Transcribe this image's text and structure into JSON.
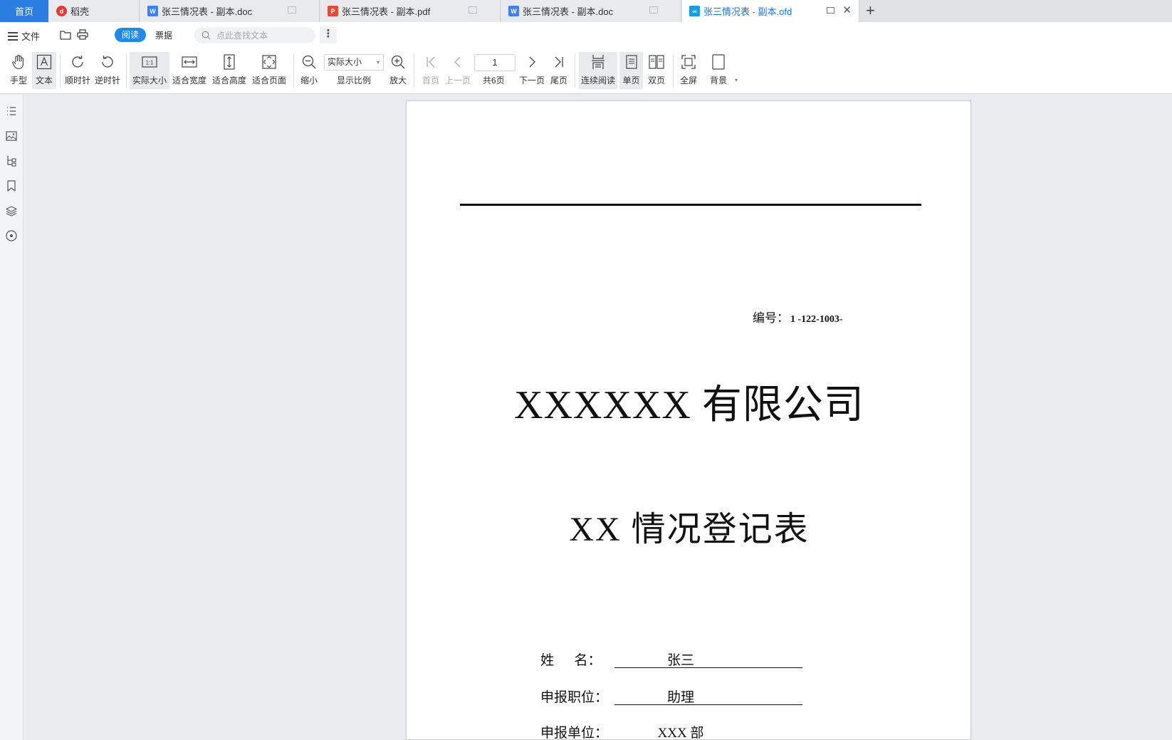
{
  "tabs": [
    {
      "label": "首页",
      "active": false
    },
    {
      "label": "稻壳",
      "active": false,
      "icon": "daoke-icon"
    },
    {
      "label": "张三情况表 - 副本.doc",
      "active": false,
      "icon": "word-doc-icon"
    },
    {
      "label": "张三情况表 - 副本.pdf",
      "active": false,
      "icon": "pdf-icon"
    },
    {
      "label": "张三情况表 - 副本.doc",
      "active": false,
      "icon": "word-doc-icon"
    },
    {
      "label": "张三情况表 - 副本.ofd",
      "active": true,
      "icon": "ofd-icon"
    }
  ],
  "menu": {
    "file_label": "文件",
    "read_mode": "阅读",
    "invoice": "票据",
    "search_placeholder": "点此查找文本"
  },
  "toolbar": {
    "hand": "手型",
    "text": "文本",
    "clockwise": "顺时针",
    "counterclockwise": "逆时针",
    "actual_size": "实际大小",
    "fit_width": "适合宽度",
    "fit_height": "适合高度",
    "fit_page": "适合页面",
    "zoom_out": "缩小",
    "zoom_value": "实际大小",
    "zoom_ratio": "显示比例",
    "zoom_in": "放大",
    "first_page": "首页",
    "prev_page": "上一页",
    "current_page": "1",
    "total_pages": "共6页",
    "next_page": "下一页",
    "last_page": "尾页",
    "continuous": "连续阅读",
    "single": "单页",
    "double": "双页",
    "fullscreen": "全屏",
    "background": "背景"
  },
  "document": {
    "number_label": "编号：",
    "number_value": "1 -122-1003-",
    "company": "XXXXXX 有限公司",
    "form_title": "XX 情况登记表",
    "fields": [
      {
        "label": "姓      名：",
        "value": "张三"
      },
      {
        "label": "申报职位：",
        "value": "助理"
      },
      {
        "label": "申报单位：",
        "value": "XXX 部"
      }
    ]
  },
  "colors": {
    "accent": "#1f8be8",
    "home_tab": "#2a7de1",
    "background": "#eaecf0"
  }
}
